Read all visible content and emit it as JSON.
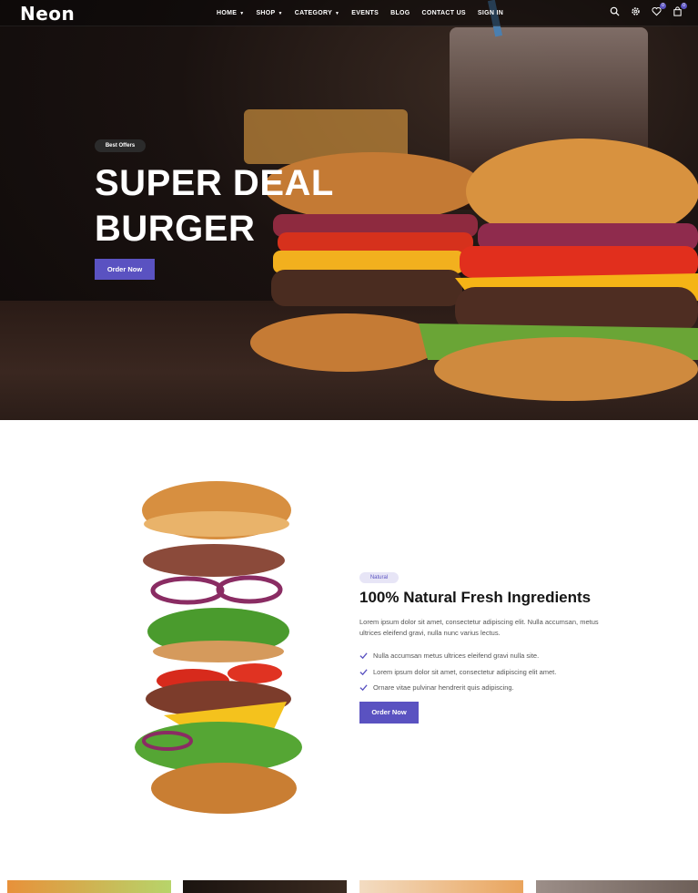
{
  "brand": {
    "logo_text": "Neon",
    "accent": "#5a52c1"
  },
  "nav": {
    "items": [
      {
        "label": "HOME",
        "dropdown": true
      },
      {
        "label": "SHOP",
        "dropdown": true
      },
      {
        "label": "CATEGORY",
        "dropdown": true
      },
      {
        "label": "EVENTS",
        "dropdown": false
      },
      {
        "label": "BLOG",
        "dropdown": false
      },
      {
        "label": "CONTACT US",
        "dropdown": false
      },
      {
        "label": "SIGN IN",
        "dropdown": false
      }
    ],
    "icons": [
      "search-icon",
      "settings-icon",
      "heart-icon",
      "cart-icon"
    ],
    "wishlist_count": "0",
    "cart_count": "0"
  },
  "hero": {
    "badge": "Best Offers",
    "title_line1": "SUPER DEAL",
    "title_line2": "BURGER",
    "button": "Order Now"
  },
  "ingredients": {
    "badge": "Natural",
    "title": "100% Natural Fresh Ingredients",
    "description": "Lorem ipsum dolor sit amet, consectetur adipiscing elit. Nulla accumsan, metus ultrices eleifend gravi, nulla nunc varius lectus.",
    "checklist": [
      "Nulla accumsan metus ultrices eleifend gravi nulla site.",
      "Lorem ipsum dolor sit amet, consectetur adipiscing elit amet.",
      "Ornare vitae pulvinar hendrerit quis adipiscing."
    ],
    "button": "Order Now"
  }
}
